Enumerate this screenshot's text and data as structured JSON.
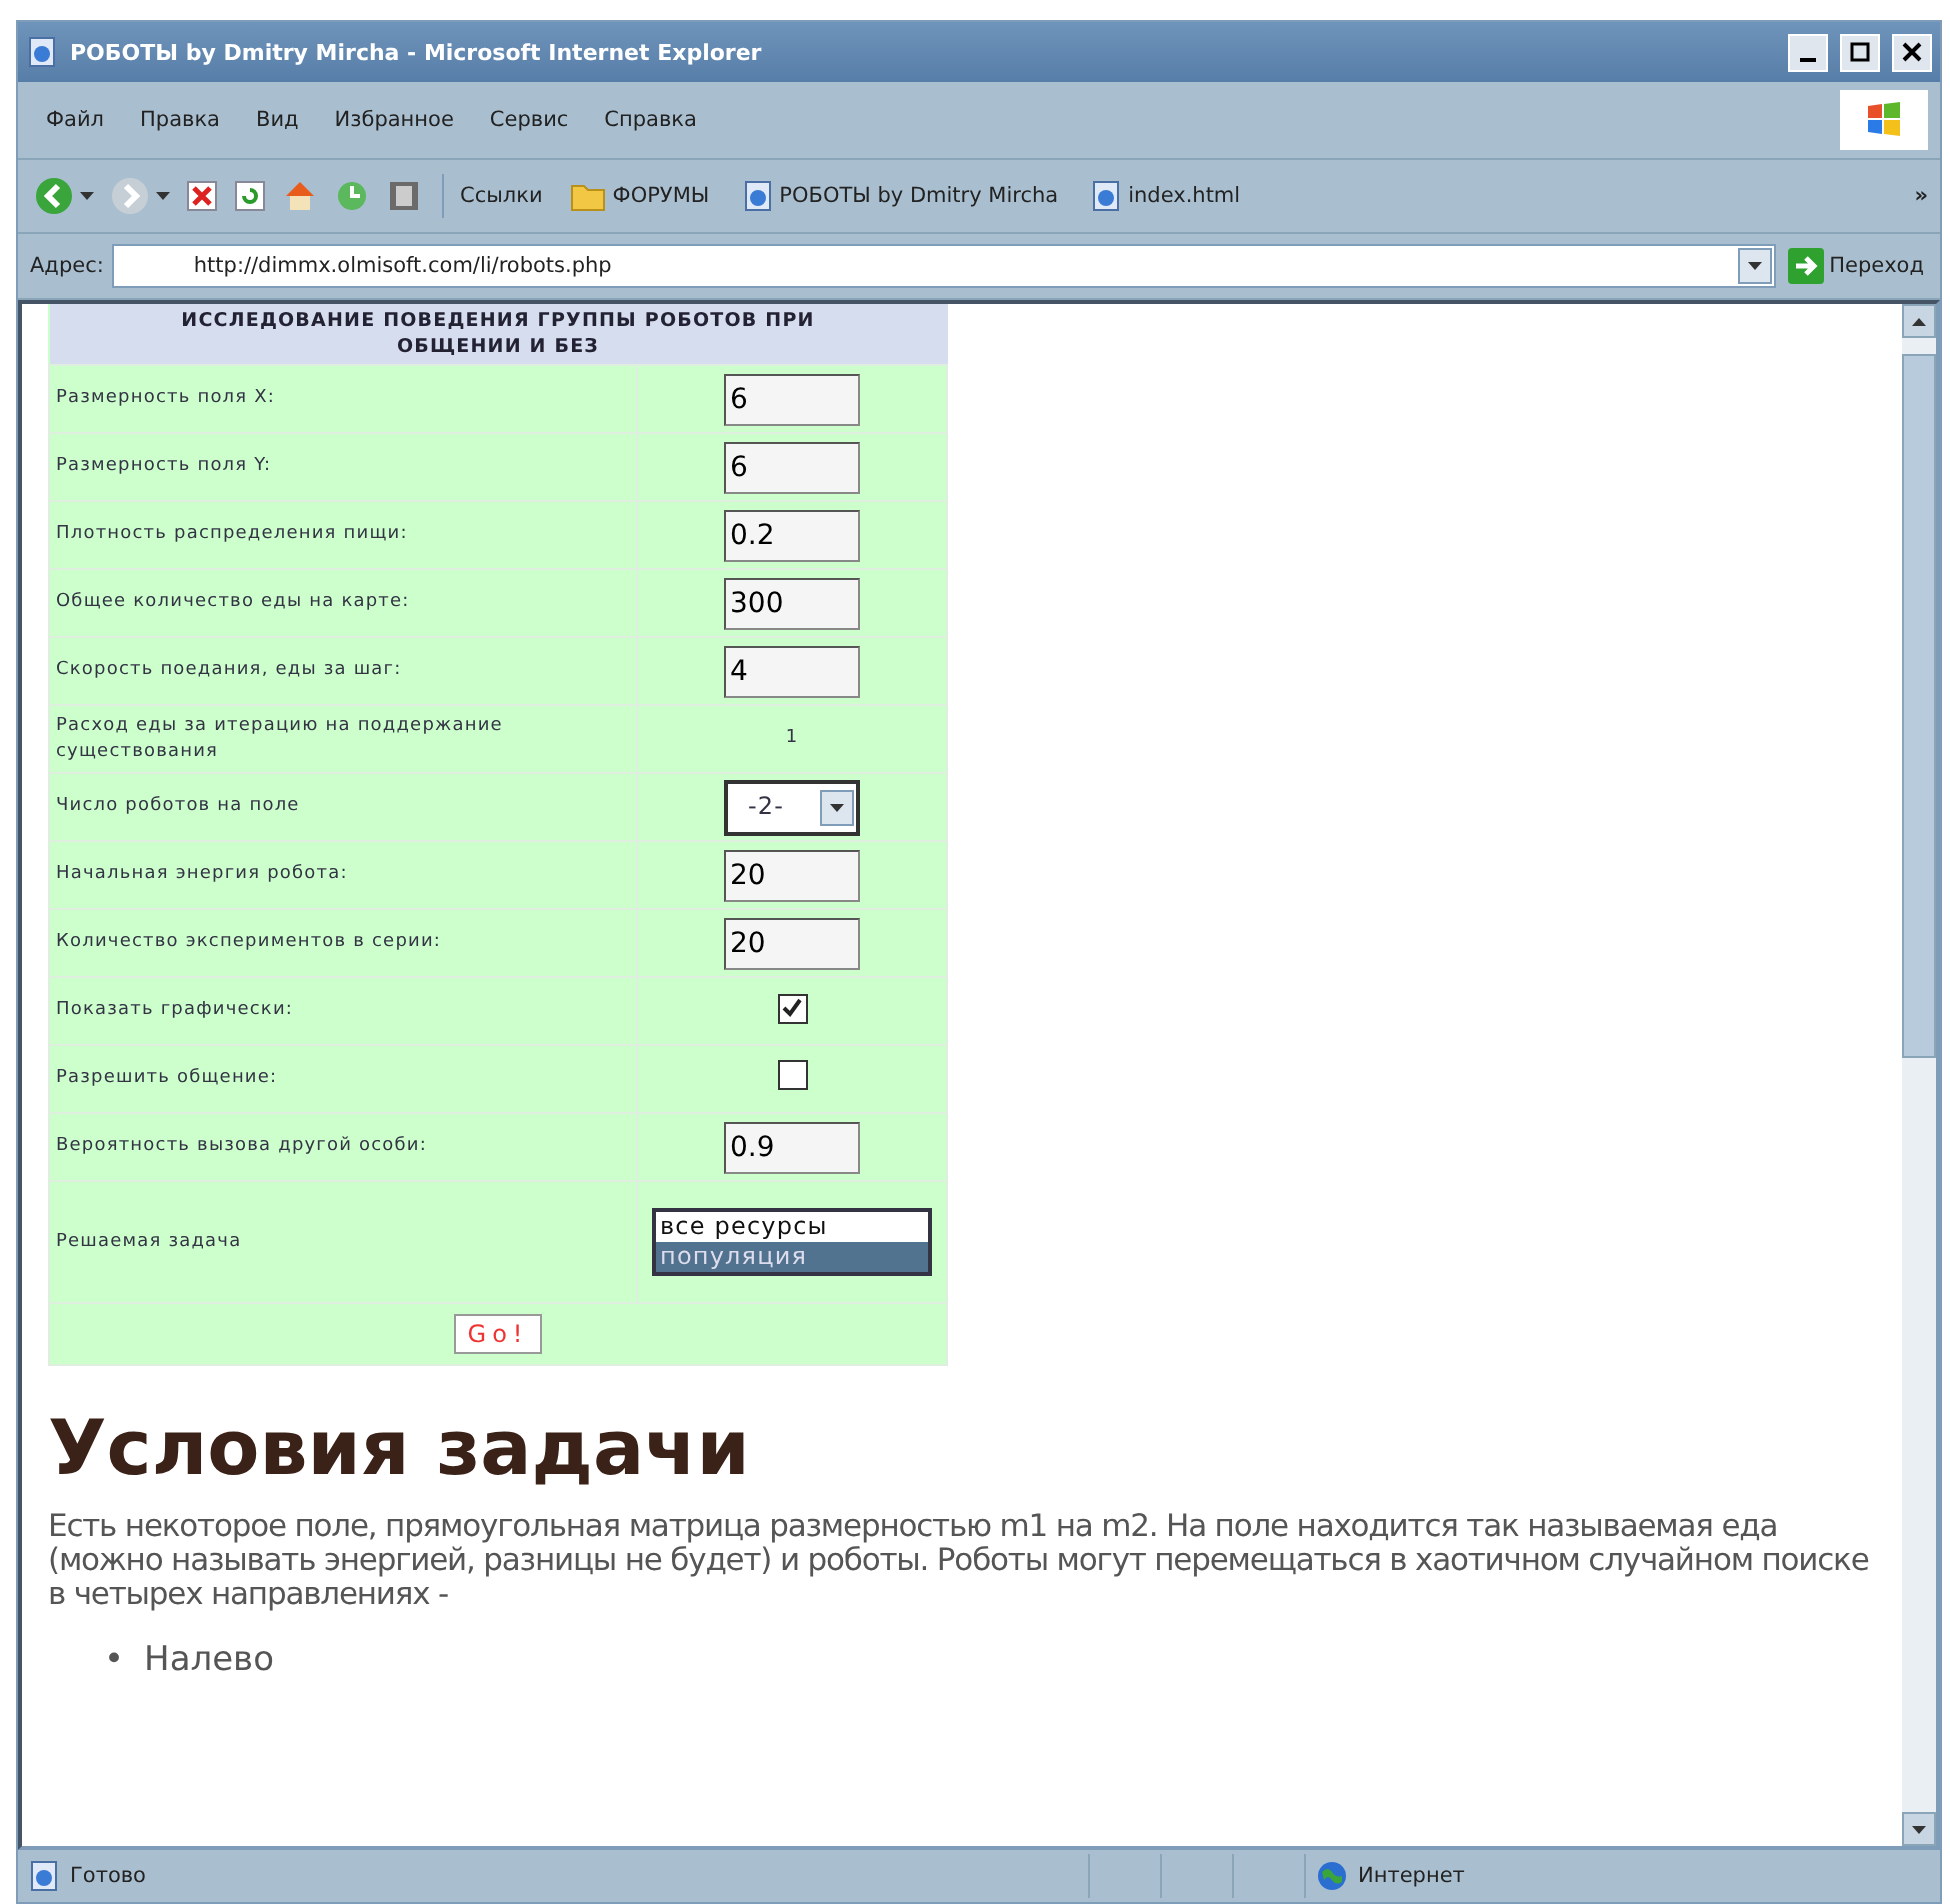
{
  "window": {
    "title": "РОБОТЫ by Dmitry Mircha - Microsoft Internet Explorer"
  },
  "menu": [
    "Файл",
    "Правка",
    "Вид",
    "Избранное",
    "Сервис",
    "Справка"
  ],
  "links": {
    "label": "Ссылки",
    "items": [
      {
        "label": "ФОРУМЫ",
        "kind": "folder"
      },
      {
        "label": "РОБОТЫ by Dmitry Mircha",
        "kind": "page"
      },
      {
        "label": "index.html",
        "kind": "page"
      }
    ],
    "more": "»"
  },
  "address": {
    "label": "Адрес:",
    "value": "http://dimmx.olmisoft.com/li/robots.php",
    "go": "Переход"
  },
  "form": {
    "title": "ИССЛЕДОВАНИЕ ПОВЕДЕНИЯ ГРУППЫ РОБОТОВ ПРИ ОБЩЕНИИ И БЕЗ",
    "rows": [
      {
        "label": "Размерность поля X:",
        "kind": "text",
        "value": "6"
      },
      {
        "label": "Размерность поля Y:",
        "kind": "text",
        "value": "6"
      },
      {
        "label": "Плотность распределения пищи:",
        "kind": "text",
        "value": "0.2"
      },
      {
        "label": "Общее количество еды на карте:",
        "kind": "text",
        "value": "300"
      },
      {
        "label": "Скорость поедания, еды за шаг:",
        "kind": "text",
        "value": "4"
      },
      {
        "label": "Расход еды за итерацию на поддержание существования",
        "kind": "static",
        "value": "1"
      },
      {
        "label": "Число роботов на поле",
        "kind": "select",
        "value": "-2-"
      },
      {
        "label": "Начальная энергия робота:",
        "kind": "text",
        "value": "20"
      },
      {
        "label": "Количество экспериментов в серии:",
        "kind": "text",
        "value": "20"
      },
      {
        "label": "Показать графически:",
        "kind": "checkbox",
        "checked": true
      },
      {
        "label": "Разрешить общение:",
        "kind": "checkbox",
        "checked": false
      },
      {
        "label": "Вероятность вызова другой особи:",
        "kind": "text",
        "value": "0.9"
      },
      {
        "label": "Решаемая задача",
        "kind": "listbox",
        "options": [
          {
            "label": "все ресурсы",
            "selected": false
          },
          {
            "label": "популяция",
            "selected": true
          }
        ]
      }
    ],
    "submit": "Go!"
  },
  "article": {
    "heading": "Условия задачи",
    "paragraph": "Есть некоторое поле, прямоугольная матрица размерностью m1 на m2. На поле находится так называемая еда (можно называть энергией, разницы не будет) и роботы. Роботы могут перемещаться в хаотичном случайном поиске в четырех направлениях -",
    "list": [
      {
        "marker": "•",
        "text": "Налево"
      }
    ]
  },
  "status": {
    "text": "Готово",
    "zone": "Интернет"
  }
}
